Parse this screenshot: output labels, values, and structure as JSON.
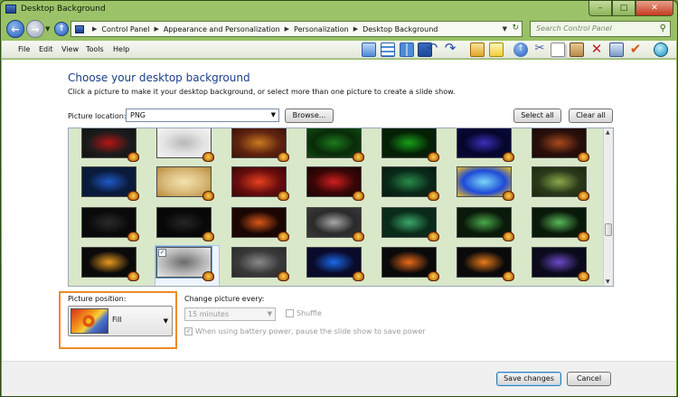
{
  "window": {
    "title": "Desktop Background"
  },
  "window_controls": {
    "minimize": "–",
    "maximize": "□",
    "close": "✕"
  },
  "breadcrumb": [
    "Control Panel",
    "Appearance and Personalization",
    "Personalization",
    "Desktop Background"
  ],
  "search": {
    "placeholder": "Search Control Panel"
  },
  "menu": [
    "File",
    "Edit",
    "View",
    "Tools",
    "Help"
  ],
  "toolbar_icons": [
    "large-icons-view-icon",
    "details-view-icon",
    "list-view-icon",
    "tiles-view-icon",
    "undo-icon",
    "redo-icon",
    "folders-icon",
    "bookmark-icon",
    "up-folder-icon",
    "cut-icon",
    "copy-icon",
    "paste-icon",
    "delete-icon",
    "properties-icon",
    "checkmark-icon",
    "web-icon"
  ],
  "page": {
    "heading": "Choose your desktop background",
    "subtext": "Click a picture to make it your desktop background, or select more than one picture to create a slide show.",
    "location_label": "Picture location:",
    "location_value": "PNG",
    "browse_label": "Browse...",
    "select_all_label": "Select all",
    "clear_all_label": "Clear all"
  },
  "gallery": {
    "thumbnails": [
      {
        "row": 0,
        "col": 0,
        "colors": [
          "#1c1c1c",
          "#b51414",
          "#111111"
        ],
        "selected": false
      },
      {
        "row": 0,
        "col": 1,
        "colors": [
          "#e4e4e4",
          "#b8b8b8",
          "#f4f4f4"
        ],
        "selected": false
      },
      {
        "row": 0,
        "col": 2,
        "colors": [
          "#612410",
          "#c87a1e",
          "#3a1208"
        ],
        "selected": false
      },
      {
        "row": 0,
        "col": 3,
        "colors": [
          "#0a2a0a",
          "#1b7a1b",
          "#0f4a0f"
        ],
        "selected": false
      },
      {
        "row": 0,
        "col": 4,
        "colors": [
          "#062006",
          "#16a016",
          "#062006"
        ],
        "selected": false
      },
      {
        "row": 0,
        "col": 5,
        "colors": [
          "#05052a",
          "#3a2fb8",
          "#0a0a40"
        ],
        "selected": false
      },
      {
        "row": 0,
        "col": 6,
        "colors": [
          "#2a0f0a",
          "#a84a1e",
          "#1a0a08"
        ],
        "selected": false
      },
      {
        "row": 1,
        "col": 0,
        "colors": [
          "#0a1a3a",
          "#1e5ac8",
          "#0a1a3a"
        ],
        "selected": false
      },
      {
        "row": 1,
        "col": 1,
        "colors": [
          "#d8b878",
          "#f3e2b0",
          "#b88a3a"
        ],
        "selected": false
      },
      {
        "row": 1,
        "col": 2,
        "colors": [
          "#6a0e0e",
          "#e8401e",
          "#3a0606"
        ],
        "selected": false
      },
      {
        "row": 1,
        "col": 3,
        "colors": [
          "#3a0606",
          "#d01e1e",
          "#1a0404"
        ],
        "selected": false
      },
      {
        "row": 1,
        "col": 4,
        "colors": [
          "#0a2a1a",
          "#2a8a4a",
          "#061a0e"
        ],
        "selected": false
      },
      {
        "row": 1,
        "col": 5,
        "colors": [
          "#1e4ad8",
          "#7ad8f8",
          "#f0c020"
        ],
        "selected": false
      },
      {
        "row": 1,
        "col": 6,
        "colors": [
          "#2a3a1a",
          "#8aa84a",
          "#1a2a0e"
        ],
        "selected": false
      },
      {
        "row": 2,
        "col": 0,
        "colors": [
          "#0a0a0a",
          "#2a2a2a",
          "#0a0a0a"
        ],
        "selected": false
      },
      {
        "row": 2,
        "col": 1,
        "colors": [
          "#080808",
          "#262626",
          "#080808"
        ],
        "selected": false
      },
      {
        "row": 2,
        "col": 2,
        "colors": [
          "#1a0602",
          "#d8581a",
          "#1a0602"
        ],
        "selected": false
      },
      {
        "row": 2,
        "col": 3,
        "colors": [
          "#2a2a2a",
          "#a8a8a8",
          "#3a3a3a"
        ],
        "selected": false
      },
      {
        "row": 2,
        "col": 4,
        "colors": [
          "#0a2a1a",
          "#3aa86a",
          "#0a2a1a"
        ],
        "selected": false
      },
      {
        "row": 2,
        "col": 5,
        "colors": [
          "#0a1a0a",
          "#4aa84a",
          "#0a1a0a"
        ],
        "selected": false
      },
      {
        "row": 2,
        "col": 6,
        "colors": [
          "#0a1a0a",
          "#5ab85a",
          "#0a1a0a"
        ],
        "selected": false
      },
      {
        "row": 3,
        "col": 0,
        "colors": [
          "#0a0a0a",
          "#e89a1e",
          "#0a0a0a"
        ],
        "selected": false
      },
      {
        "row": 3,
        "col": 1,
        "colors": [
          "#b8b8b8",
          "#6a6a6a",
          "#e8e8e8"
        ],
        "selected": true
      },
      {
        "row": 3,
        "col": 2,
        "colors": [
          "#3a3a3a",
          "#8a8a8a",
          "#2a2a2a"
        ],
        "selected": false
      },
      {
        "row": 3,
        "col": 3,
        "colors": [
          "#0a0a2a",
          "#1a6ae8",
          "#0a0a2a"
        ],
        "selected": false
      },
      {
        "row": 3,
        "col": 4,
        "colors": [
          "#0a0a0a",
          "#e86a1a",
          "#0a0a0a"
        ],
        "selected": false
      },
      {
        "row": 3,
        "col": 5,
        "colors": [
          "#0a0a0a",
          "#e87a1a",
          "#0a0a0a"
        ],
        "selected": false
      },
      {
        "row": 3,
        "col": 6,
        "colors": [
          "#0a0a1a",
          "#6a4ac8",
          "#0a0a1a"
        ],
        "selected": false
      }
    ]
  },
  "position": {
    "label": "Picture position:",
    "value": "Fill"
  },
  "slideshow": {
    "change_label": "Change picture every:",
    "interval_value": "15 minutes",
    "shuffle_label": "Shuffle",
    "shuffle_checked": false,
    "battery_label": "When using battery power, pause the slide show to save power",
    "battery_checked": true
  },
  "footer": {
    "save_label": "Save changes",
    "cancel_label": "Cancel"
  },
  "colors": {
    "chrome": "#79a843",
    "highlight": "#ee8c25",
    "heading": "#1a3e86"
  }
}
